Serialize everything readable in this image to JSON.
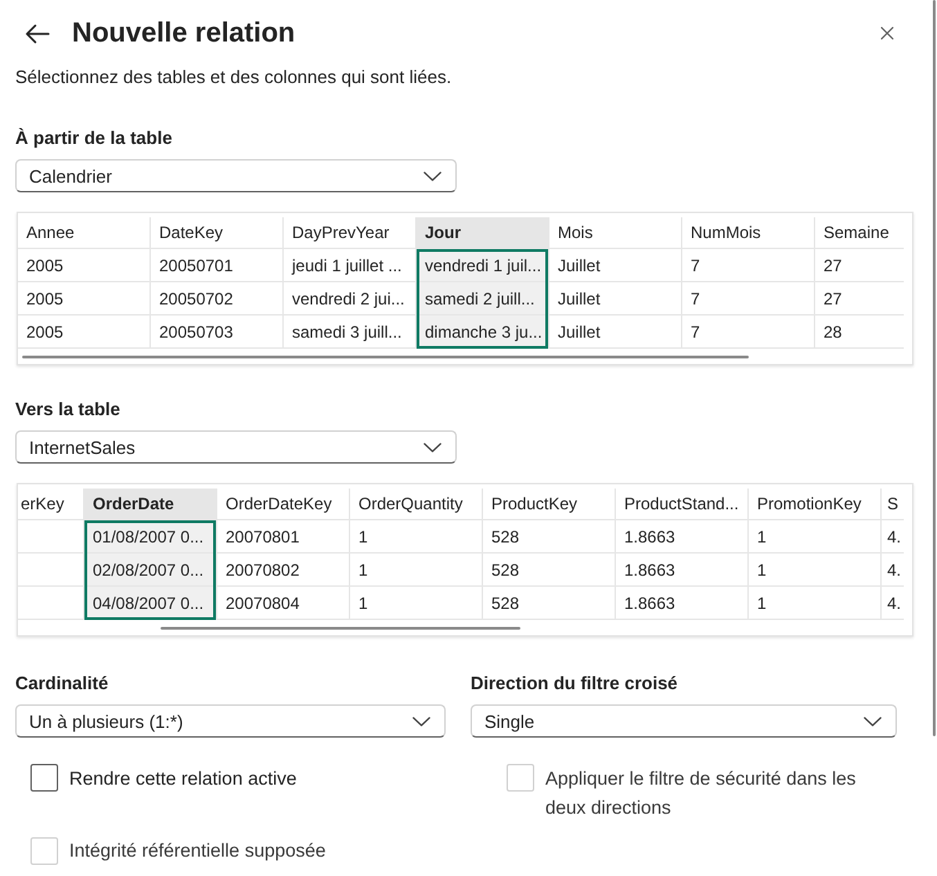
{
  "title": "Nouvelle relation",
  "subtitle": "Sélectionnez des tables et des colonnes qui sont liées.",
  "from_table": {
    "label": "À partir de la table",
    "value": "Calendrier",
    "columns": [
      {
        "name": "Annee",
        "selected": false
      },
      {
        "name": "DateKey",
        "selected": false
      },
      {
        "name": "DayPrevYear",
        "selected": false
      },
      {
        "name": "Jour",
        "selected": true
      },
      {
        "name": "Mois",
        "selected": false
      },
      {
        "name": "NumMois",
        "selected": false
      },
      {
        "name": "Semaine",
        "selected": false
      }
    ],
    "rows": [
      [
        "2005",
        "20050701",
        "jeudi 1 juillet ...",
        "vendredi 1 juil...",
        "Juillet",
        "7",
        "27"
      ],
      [
        "2005",
        "20050702",
        "vendredi 2 jui...",
        "samedi 2 juill...",
        "Juillet",
        "7",
        "27"
      ],
      [
        "2005",
        "20050703",
        "samedi 3 juill...",
        "dimanche 3 ju...",
        "Juillet",
        "7",
        "28"
      ]
    ]
  },
  "to_table": {
    "label": "Vers la table",
    "value": "InternetSales",
    "columns": [
      {
        "name": "erKey",
        "selected": false
      },
      {
        "name": "OrderDate",
        "selected": true
      },
      {
        "name": "OrderDateKey",
        "selected": false
      },
      {
        "name": "OrderQuantity",
        "selected": false
      },
      {
        "name": "ProductKey",
        "selected": false
      },
      {
        "name": "ProductStand...",
        "selected": false
      },
      {
        "name": "PromotionKey",
        "selected": false
      },
      {
        "name": "S",
        "selected": false
      }
    ],
    "rows": [
      [
        null,
        "01/08/2007 0...",
        "20070801",
        "1",
        "528",
        "1.8663",
        "1",
        "4."
      ],
      [
        null,
        "02/08/2007 0...",
        "20070802",
        "1",
        "528",
        "1.8663",
        "1",
        "4."
      ],
      [
        null,
        "04/08/2007 0...",
        "20070804",
        "1",
        "528",
        "1.8663",
        "1",
        "4."
      ]
    ]
  },
  "cardinality": {
    "label": "Cardinalité",
    "value": "Un à plusieurs (1:*)"
  },
  "cross_filter": {
    "label": "Direction du filtre croisé",
    "value": "Single"
  },
  "options": [
    {
      "label": "Rendre cette relation active",
      "checked": false,
      "disabled": false
    },
    {
      "label": "Appliquer le filtre de sécurité dans les deux directions",
      "checked": false,
      "disabled": true
    },
    {
      "label": "Intégrité référentielle supposée",
      "checked": false,
      "disabled": true
    }
  ]
}
